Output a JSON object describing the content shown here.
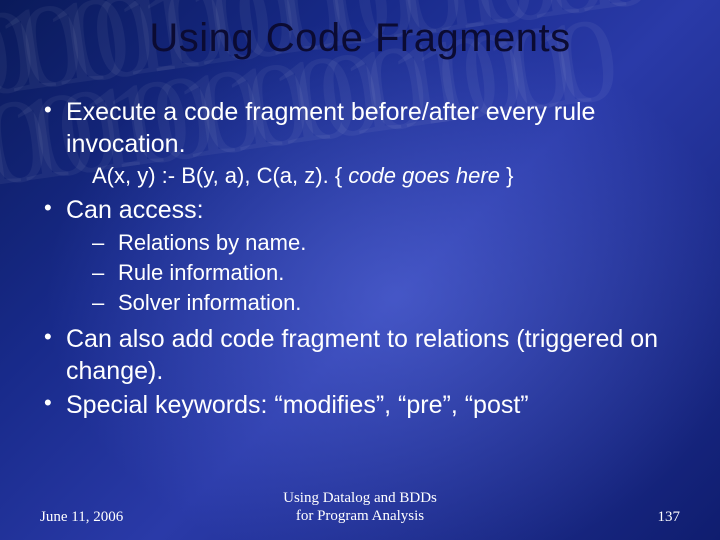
{
  "title": "Using Code Fragments",
  "bullets": {
    "b1": "Execute a code fragment before/after every rule invocation.",
    "code_prefix": "A(x, y) :- B(y, a), C(a, z).  { ",
    "code_ital": "code goes here",
    "code_suffix": " }",
    "b2": "Can access:",
    "sub1": "Relations by name.",
    "sub2": "Rule information.",
    "sub3": "Solver information.",
    "b3": "Can also add code fragment to relations (triggered on change).",
    "b4": "Special keywords: “modifies”, “pre”, “post”"
  },
  "footer": {
    "date": "June 11, 2006",
    "center1": "Using Datalog and BDDs",
    "center2": "for Program Analysis",
    "page": "137"
  }
}
